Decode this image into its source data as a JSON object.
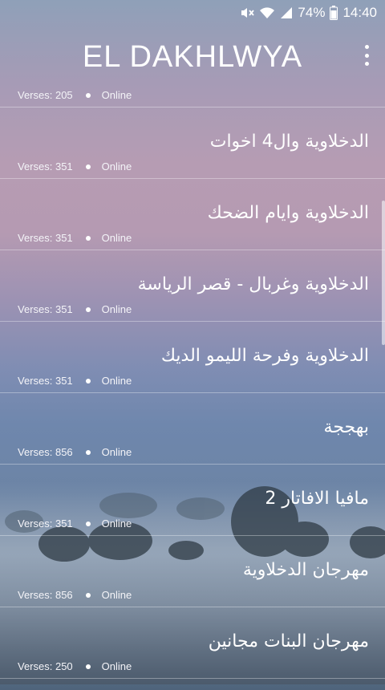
{
  "status_bar": {
    "battery": "74%",
    "time": "14:40"
  },
  "app_bar": {
    "title": "EL DAKHLWYA",
    "menu_icon": "more-vert-icon"
  },
  "list": {
    "items": [
      {
        "title": "",
        "verses": "Verses: 205",
        "status": "Online"
      },
      {
        "title": "الدخلاوية وال4 اخوات",
        "verses": "Verses: 351",
        "status": "Online"
      },
      {
        "title": "الدخلاوية وايام الضحك",
        "verses": "Verses: 351",
        "status": "Online"
      },
      {
        "title": "الدخلاوية وغربال - قصر الرياسة",
        "verses": "Verses: 351",
        "status": "Online"
      },
      {
        "title": "الدخلاوية وفرحة الليمو الديك",
        "verses": "Verses: 351",
        "status": "Online"
      },
      {
        "title": "بهججة",
        "verses": "Verses: 856",
        "status": "Online"
      },
      {
        "title": "مافيا الافاتار 2",
        "verses": "Verses: 351",
        "status": "Online"
      },
      {
        "title": "مهرجان الدخلاوية",
        "verses": "Verses: 856",
        "status": "Online"
      },
      {
        "title": "مهرجان البنات مجانين",
        "verses": "Verses: 250",
        "status": "Online"
      }
    ]
  }
}
